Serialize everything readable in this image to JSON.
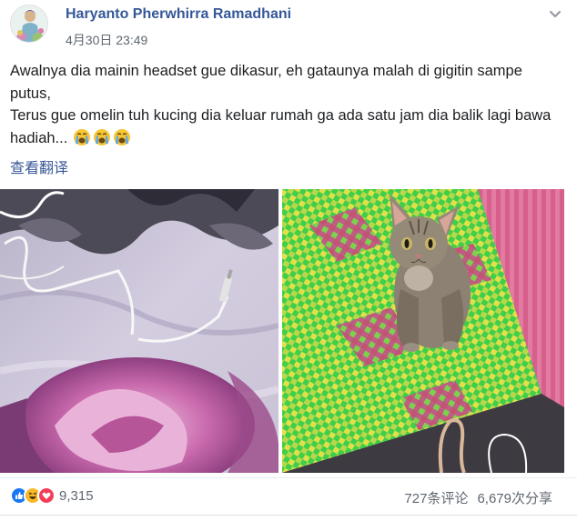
{
  "post": {
    "author": "Haryanto Pherwhirra Ramadhani",
    "timestamp": "4月30日 23:49",
    "text_line_1": "Awalnya dia mainin headset gue dikasur, eh gataunya malah di gigitin sampe putus,",
    "text_line_2": "Terus gue omelin tuh kucing dia keluar rumah ga ada satu jam dia balik lagi bawa hadiah...",
    "emojis": [
      "crying-face-emoji",
      "crying-face-emoji",
      "crying-face-emoji"
    ],
    "translate_link": "查看翻译"
  },
  "photos": [
    {
      "icon": "broken-headset-cable-photo"
    },
    {
      "icon": "cat-on-mat-photo"
    }
  ],
  "footer": {
    "reactions": [
      "like-reaction-icon",
      "haha-reaction-icon",
      "love-reaction-icon"
    ],
    "reaction_count": "9,315",
    "comments": "727条评论",
    "shares": "6,679次分享"
  },
  "colors": {
    "link": "#365899",
    "like": "#1877f2",
    "haha": "#f7b928",
    "love": "#f33e58",
    "secondary_text": "#606770"
  }
}
